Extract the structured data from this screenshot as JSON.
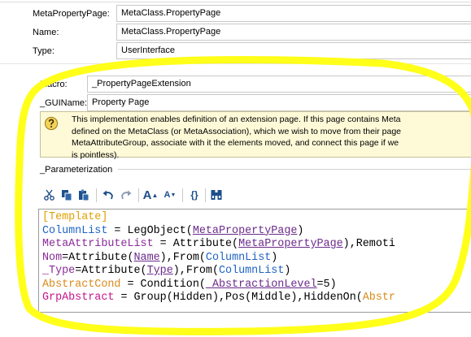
{
  "top_fields": [
    {
      "label": "MetaPropertyPage:",
      "value": "MetaClass.PropertyPage"
    },
    {
      "label": "Name:",
      "value": "MetaClass.PropertyPage"
    },
    {
      "label": "Type:",
      "value": "UserInterface"
    }
  ],
  "macro": {
    "label": "Macro:",
    "value": "_PropertyPageExtension"
  },
  "guiname": {
    "label": "_GUIName:",
    "value": "Property Page"
  },
  "help": {
    "icon": "help-question-icon",
    "lines": [
      "This implementation enables definition of an extension page. If this page contains Meta",
      "defined on the MetaClass (or MetaAssociation), which we wish to move from their page",
      "MetaAttributeGroup, associate with it the elements moved, and connect this page if we",
      "is pointless)."
    ]
  },
  "parameterization": {
    "label": "_Parameterization"
  },
  "toolbar": {
    "icons": [
      "cut-icon",
      "copy-icon",
      "paste-icon",
      "undo-icon",
      "redo-icon",
      "increase-font-icon",
      "decrease-font-icon",
      "braces-icon",
      "find-icon"
    ]
  },
  "code": {
    "line1": {
      "t": "[Template]"
    },
    "line2": {
      "a": "ColumnList",
      "b": " = LegObject(",
      "c": "MetaPropertyPage",
      "d": ")"
    },
    "line3": {
      "a": "MetaAttributeList",
      "b": " = Attribute(",
      "c": "MetaPropertyPage",
      "d": "),Remoti"
    },
    "line4": {
      "a": "Nom",
      "b": "=Attribute(",
      "c": "Name",
      "d": "),From(",
      "e": "ColumnList",
      "f": ")"
    },
    "line5": {
      "a": "_Type",
      "b": "=Attribute(",
      "c": "Type",
      "d": "),From(",
      "e": "ColumnList",
      "f": ")"
    },
    "line6": {
      "a": "AbstractCond",
      "b": " = Condition(",
      "c": "_AbstractionLevel",
      "d": "=5)"
    },
    "line7": {
      "a": "GrpAbstract",
      "b": " = Group(Hidden),Pos(Middle),HiddenOn(",
      "c": "Abstr"
    }
  },
  "colors": {
    "highlight": "#ffff1a",
    "help_bg": "#fefad8"
  }
}
